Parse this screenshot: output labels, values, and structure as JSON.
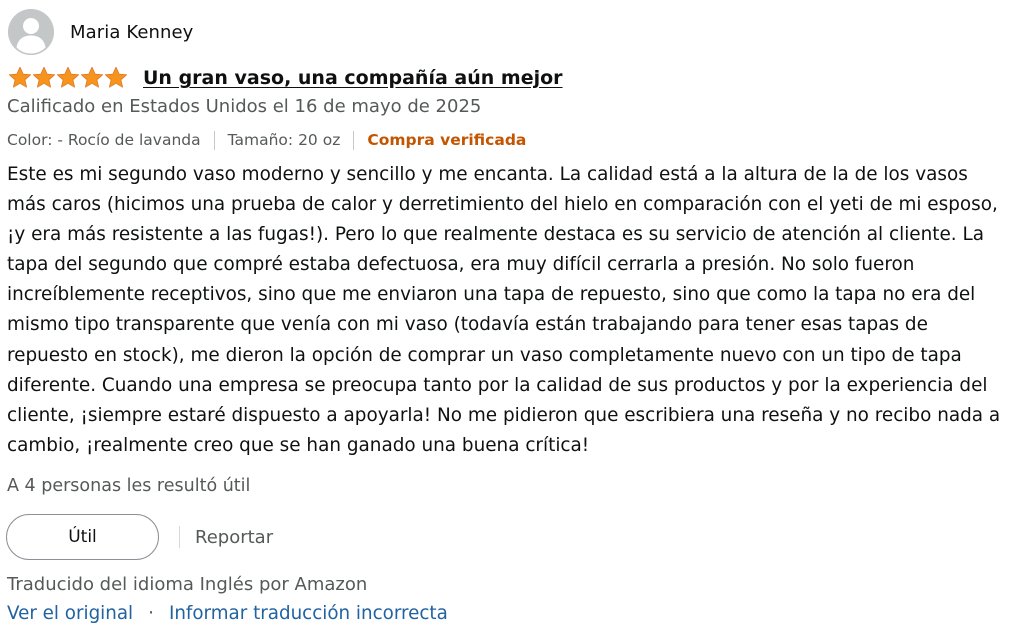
{
  "profile": {
    "avatar_icon": "user-silhouette-icon",
    "name": "Maria Kenney"
  },
  "review": {
    "rating": 5,
    "rating_max": 5,
    "star_color": "#f7941d",
    "star_icon": "star-icon",
    "title": "Un gran vaso, una compañía aún mejor",
    "date_text": "Calificado en Estados Unidos el 16 de mayo de 2025",
    "attributes": {
      "color": "Color: - Rocío de lavanda",
      "size": "Tamaño: 20 oz",
      "verified": "Compra verificada",
      "verified_color": "#c45500"
    },
    "body": "Este es mi segundo vaso moderno y sencillo y me encanta. La calidad está a la altura de la de los vasos más caros (hicimos una prueba de calor y derretimiento del hielo en comparación con el yeti de mi esposo, ¡y era más resistente a las fugas!). Pero lo que realmente destaca es su servicio de atención al cliente. La tapa del segundo que compré estaba defectuosa, era muy difícil cerrarla a presión. No solo fueron increíblemente receptivos, sino que me enviaron una tapa de repuesto, sino que como la tapa no era del mismo tipo transparente que venía con mi vaso (todavía están trabajando para tener esas tapas de repuesto en stock), me dieron la opción de comprar un vaso completamente nuevo con un tipo de tapa diferente. Cuando una empresa se preocupa tanto por la calidad de sus productos y por la experiencia del cliente, ¡siempre estaré dispuesto a apoyarla! No me pidieron que escribiera una reseña y no recibo nada a cambio, ¡realmente creo que se han ganado una buena crítica!",
    "helpful_count_text": "A 4 personas les resultó útil"
  },
  "actions": {
    "helpful_label": "Útil",
    "report_label": "Reportar"
  },
  "translation": {
    "note": "Traducido del idioma Inglés por Amazon",
    "view_original": "Ver el original",
    "separator": "·",
    "report_translation": "Informar traducción incorrecta",
    "link_color": "#2162a1"
  }
}
